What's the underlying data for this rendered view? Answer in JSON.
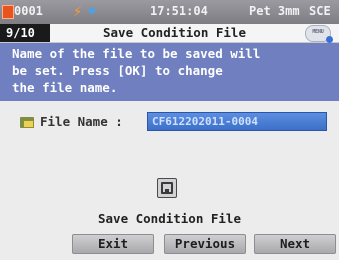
{
  "status_bar": {
    "channel": "0001",
    "time": "17:51:04",
    "obs": "Pet",
    "aperture": "3mm",
    "mode": "SCE",
    "icons": [
      "record-badge-icon",
      "battery-bolt-icon",
      "connection-icon"
    ]
  },
  "title_bar": {
    "page": "9/10",
    "title": "Save Condition File",
    "menu_label": "MENU"
  },
  "message": "Name of the file to be saved will\nbe set. Press [OK] to change\nthe file name.",
  "file_row": {
    "label": "File Name :",
    "value": "CF612202011-0004"
  },
  "save_section": {
    "label": "Save Condition File"
  },
  "buttons": {
    "exit": "Exit",
    "previous": "Previous",
    "next": "Next"
  },
  "colors": {
    "message_bg": "#6f7fbf",
    "field_bg": "#3c6fc8",
    "status_bg": "#8a8990"
  }
}
